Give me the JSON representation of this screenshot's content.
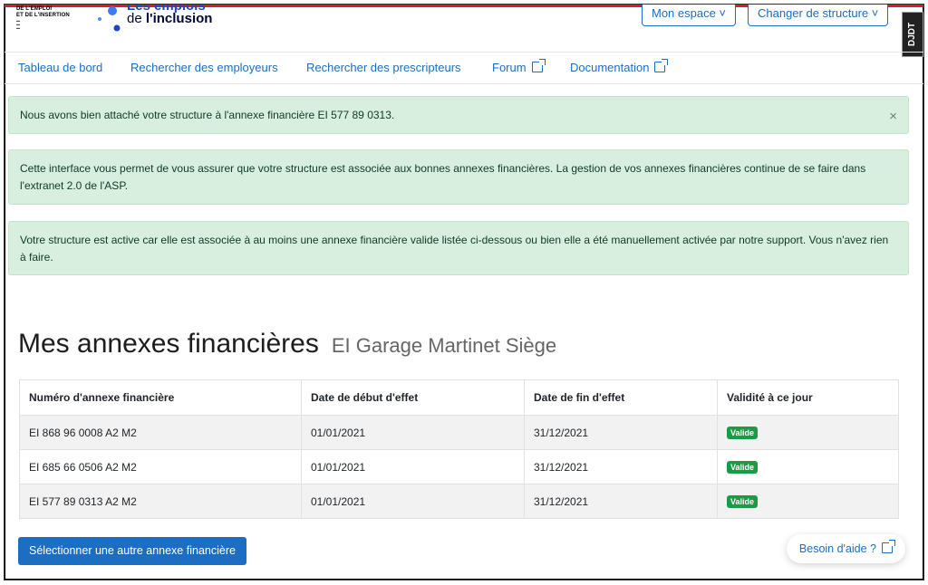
{
  "header": {
    "gov_logo_lines": [
      "DE L'EMPLOI",
      "ET DE L'INSERTION"
    ],
    "brand_line1": "Les emplois",
    "brand_prefix": "de",
    "brand_main": "l'inclusion",
    "mon_espace": "Mon espace ˅",
    "changer_structure": "Changer de structure ˅",
    "debug_toolbar": "DJDT"
  },
  "nav": {
    "items": [
      {
        "label": "Tableau de bord"
      },
      {
        "label": "Rechercher des employeurs"
      },
      {
        "label": "Rechercher des prescripteurs"
      },
      {
        "label": "Forum"
      },
      {
        "label": "Documentation"
      }
    ]
  },
  "alerts": {
    "success": "Nous avons bien attaché votre structure à l'annexe financière EI 577 89 0313.",
    "close_glyph": "×",
    "info1": "Cette interface vous permet de vous assurer que votre structure est associée aux bonnes annexes financières. La gestion de vos annexes financières continue de se faire dans l'extranet 2.0 de l'ASP.",
    "info2": "Votre structure est active car elle est associée à au moins une annexe financière valide listée ci-dessous ou bien elle a été manuellement activée par notre support. Vous n'avez rien à faire."
  },
  "page": {
    "title": "Mes annexes financières",
    "subtitle": "EI Garage Martinet Siège"
  },
  "table": {
    "headers": [
      "Numéro d'annexe financière",
      "Date de début d'effet",
      "Date de fin d'effet",
      "Validité à ce jour"
    ],
    "rows": [
      {
        "numero": "EI 868 96 0008 A2 M2",
        "debut": "01/01/2021",
        "fin": "31/12/2021",
        "validite": "Valide"
      },
      {
        "numero": "EI 685 66 0506 A2 M2",
        "debut": "01/01/2021",
        "fin": "31/12/2021",
        "validite": "Valide"
      },
      {
        "numero": "EI 577 89 0313 A2 M2",
        "debut": "01/01/2021",
        "fin": "31/12/2021",
        "validite": "Valide"
      }
    ]
  },
  "actions": {
    "select_other": "Sélectionner une autre annexe financière",
    "help": "Besoin d'aide ?"
  },
  "colors": {
    "primary": "#1b6ec2",
    "success_bg": "#d8eedf",
    "badge_green": "#1a9b45",
    "top_stripe": "#d21f2e"
  },
  "icons": {
    "external_link": "external-link-icon",
    "close": "close-icon"
  }
}
